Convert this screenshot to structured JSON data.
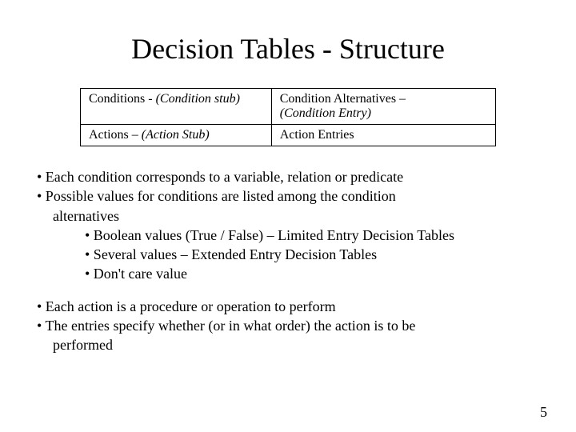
{
  "title": "Decision Tables - Structure",
  "table": {
    "r1c1_a": "Conditions - ",
    "r1c1_b": "(Condition stub)",
    "r1c2_a": "Condition Alternatives – ",
    "r1c2_b": "(Condition Entry)",
    "r2c1_a": "Actions – ",
    "r2c1_b": "(Action Stub)",
    "r2c2": "Action Entries"
  },
  "bullets": {
    "b1": "• Each condition corresponds to a variable, relation or predicate",
    "b2": "• Possible values for conditions are listed among the condition",
    "b2c": "alternatives",
    "b2_1": "• Boolean values (True / False) – Limited Entry Decision Tables",
    "b2_2": "• Several values – Extended Entry Decision Tables",
    "b2_3": "• Don't care value",
    "b3": "• Each action is a procedure or operation to perform",
    "b4": "• The entries specify whether (or in what order) the action is to be",
    "b4c": "performed"
  },
  "page_number": "5"
}
